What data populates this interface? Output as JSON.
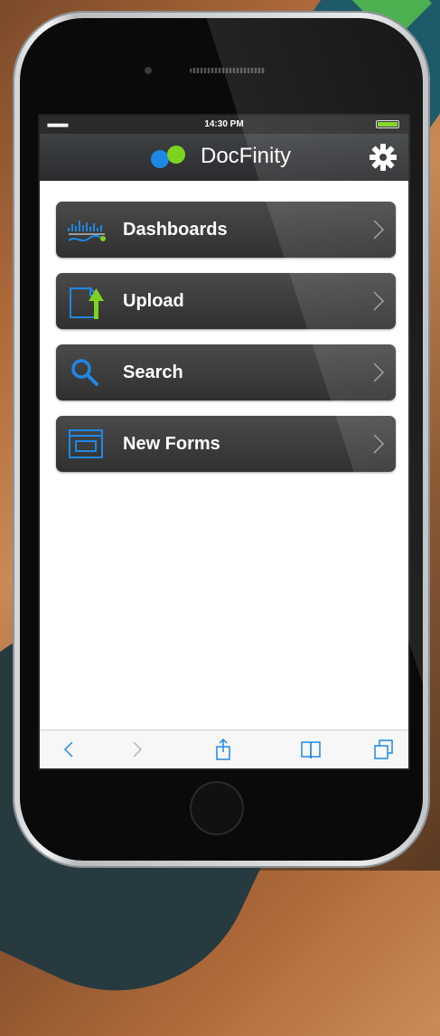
{
  "status_bar": {
    "signal": "■■■■■■",
    "time": "14:30 PM"
  },
  "header": {
    "brand": "DocFinity",
    "logo_colors": [
      "#1e88e5",
      "#7ed321"
    ]
  },
  "menu": {
    "items": [
      {
        "label": "Dashboards",
        "icon": "dashboard-chart-icon"
      },
      {
        "label": "Upload",
        "icon": "upload-arrow-icon"
      },
      {
        "label": "Search",
        "icon": "magnifier-icon"
      },
      {
        "label": "New Forms",
        "icon": "form-window-icon"
      }
    ]
  },
  "toolbar": {
    "icons": [
      "back-icon",
      "forward-icon",
      "share-icon",
      "bookmarks-icon",
      "tabs-icon"
    ]
  },
  "colors": {
    "accent_blue": "#1e88e5",
    "accent_green": "#7ed321",
    "menu_bg": "#3b3b3b"
  }
}
